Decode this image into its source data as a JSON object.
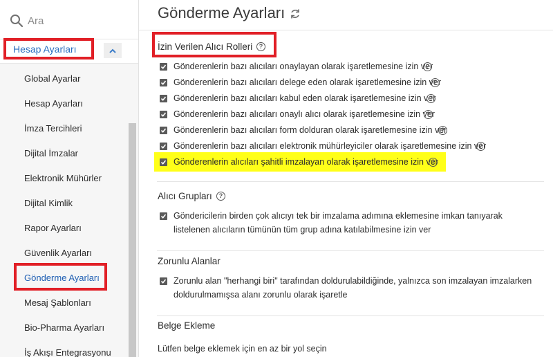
{
  "sidebar": {
    "search_placeholder": "Ara",
    "section_label": "Hesap Ayarları",
    "items": [
      {
        "label": "Global Ayarlar"
      },
      {
        "label": "Hesap Ayarları"
      },
      {
        "label": "İmza Tercihleri"
      },
      {
        "label": "Dijital İmzalar"
      },
      {
        "label": "Elektronik Mühürler"
      },
      {
        "label": "Dijital Kimlik"
      },
      {
        "label": "Rapor Ayarları"
      },
      {
        "label": "Güvenlik Ayarları"
      },
      {
        "label": "Gönderme Ayarları"
      },
      {
        "label": "Mesaj Şablonları"
      },
      {
        "label": "Bio-Pharma Ayarları"
      },
      {
        "label": "İş Akışı Entegrasyonu"
      }
    ],
    "active_item": "Gönderme Ayarları"
  },
  "main": {
    "title": "Gönderme Ayarları",
    "sections": {
      "recipient_roles": {
        "title": "İzin Verilen Alıcı Rolleri",
        "options": [
          {
            "label": "Gönderenlerin bazı alıcıları onaylayan olarak işaretlemesine izin ver",
            "checked": true
          },
          {
            "label": "Gönderenlerin bazı alıcıları delege eden olarak işaretlemesine izin ver",
            "checked": true
          },
          {
            "label": "Gönderenlerin bazı alıcıları kabul eden olarak işaretlemesine izin ver",
            "checked": true
          },
          {
            "label": "Gönderenlerin bazı alıcıları onaylı alıcı olarak işaretlemesine izin ver",
            "checked": true
          },
          {
            "label": "Gönderenlerin bazı alıcıları form dolduran olarak işaretlemesine izin ver",
            "checked": true
          },
          {
            "label": "Gönderenlerin bazı alıcıları elektronik mühürleyiciler olarak işaretlemesine izin ver",
            "checked": true
          },
          {
            "label": "Gönderenlerin alıcıları şahitli imzalayan olarak işaretlemesine izin ver",
            "checked": true
          }
        ]
      },
      "recipient_groups": {
        "title": "Alıcı Grupları",
        "option": {
          "label": "Göndericilerin birden çok alıcıyı tek bir imzalama adımına eklemesine imkan tanıyarak listelenen alıcıların tümünün tüm grup adına katılabilmesine izin ver",
          "checked": true
        }
      },
      "required_fields": {
        "title": "Zorunlu Alanlar",
        "option": {
          "label": "Zorunlu alan \"herhangi biri\" tarafından doldurulabildiğinde, yalnızca son imzalayan imzalarken doldurulmamışsa alanı zorunlu olarak işaretle",
          "checked": true
        }
      },
      "document_attach": {
        "title": "Belge Ekleme",
        "text": "Lütfen belge eklemek için en az bir yol seçin"
      }
    }
  },
  "colors": {
    "annotation_red": "#e11f26",
    "highlight_yellow": "#ffff19",
    "link_blue": "#2a6fc0"
  }
}
